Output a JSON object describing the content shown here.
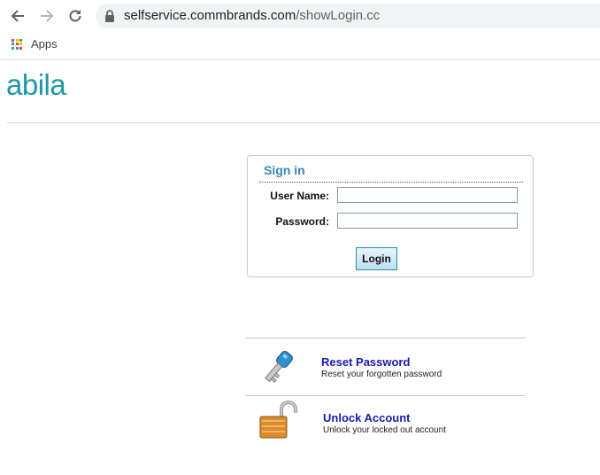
{
  "browser": {
    "url_host": "selfservice.commbrands.com",
    "url_path": "/showLogin.cc",
    "bookmarks": {
      "apps_label": "Apps"
    }
  },
  "logo": {
    "text": "abila",
    "suffix": "."
  },
  "signin": {
    "title": "Sign in",
    "username_label": "User Name:",
    "username_value": "",
    "password_label": "Password:",
    "password_value": "",
    "login_label": "Login"
  },
  "actions": [
    {
      "title": "Reset Password",
      "subtitle": "Reset your forgotten password",
      "icon": "key-icon"
    },
    {
      "title": "Unlock Account",
      "subtitle": "Unlock your locked out account",
      "icon": "padlock-icon"
    }
  ],
  "colors": {
    "logo": "#1b9aa5",
    "signin_title": "#3a86b4",
    "link": "#1a1ab0",
    "key": "#2f8fd0",
    "padlock": "#d98a2b"
  }
}
